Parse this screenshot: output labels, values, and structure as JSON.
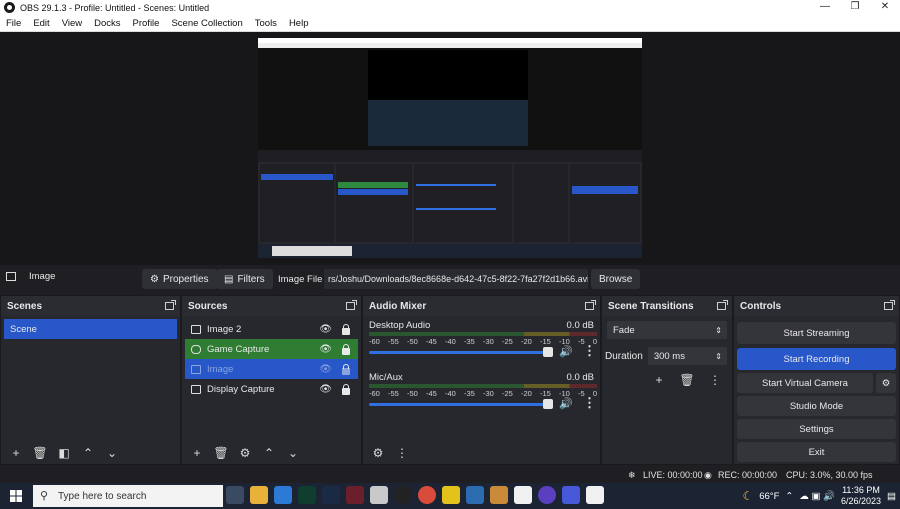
{
  "window": {
    "title": "OBS 29.1.3 - Profile: Untitled - Scenes: Untitled"
  },
  "menu": [
    "File",
    "Edit",
    "View",
    "Docks",
    "Profile",
    "Scene Collection",
    "Tools",
    "Help"
  ],
  "source_toolbar": {
    "selected_source": "Image",
    "properties_label": "Properties",
    "filters_label": "Filters",
    "image_file_label": "Image File",
    "image_file_path": "rs/Joshu/Downloads/8ec8668e-d642-47c5-8f22-7fa27f2d1b66.avif",
    "browse_label": "Browse"
  },
  "scenes": {
    "title": "Scenes",
    "items": [
      "Scene"
    ]
  },
  "sources": {
    "title": "Sources",
    "items": [
      {
        "name": "Image 2",
        "icon": "image-icon",
        "highlight": "none"
      },
      {
        "name": "Game Capture",
        "icon": "gamepad-icon",
        "highlight": "green"
      },
      {
        "name": "Image",
        "icon": "image-icon",
        "highlight": "blue"
      },
      {
        "name": "Display Capture",
        "icon": "monitor-icon",
        "highlight": "none"
      }
    ]
  },
  "audio_mixer": {
    "title": "Audio Mixer",
    "ticks": [
      "-60",
      "-55",
      "-50",
      "-45",
      "-40",
      "-35",
      "-30",
      "-25",
      "-20",
      "-15",
      "-10",
      "-5",
      "0"
    ],
    "channels": [
      {
        "name": "Desktop Audio",
        "level": "0.0 dB"
      },
      {
        "name": "Mic/Aux",
        "level": "0.0 dB"
      }
    ]
  },
  "scene_transitions": {
    "title": "Scene Transitions",
    "transition": "Fade",
    "duration_label": "Duration",
    "duration_value": "300 ms"
  },
  "controls": {
    "title": "Controls",
    "start_streaming": "Start Streaming",
    "start_recording": "Start Recording",
    "start_virtual_camera": "Start Virtual Camera",
    "studio_mode": "Studio Mode",
    "settings": "Settings",
    "exit": "Exit"
  },
  "status": {
    "live": "LIVE: 00:00:00",
    "rec": "REC: 00:00:00",
    "cpu": "CPU: 3.0%, 30.00 fps"
  },
  "taskbar": {
    "search_placeholder": "Type here to search",
    "weather": "66°F",
    "time": "11:36 PM",
    "date": "6/26/2023"
  }
}
